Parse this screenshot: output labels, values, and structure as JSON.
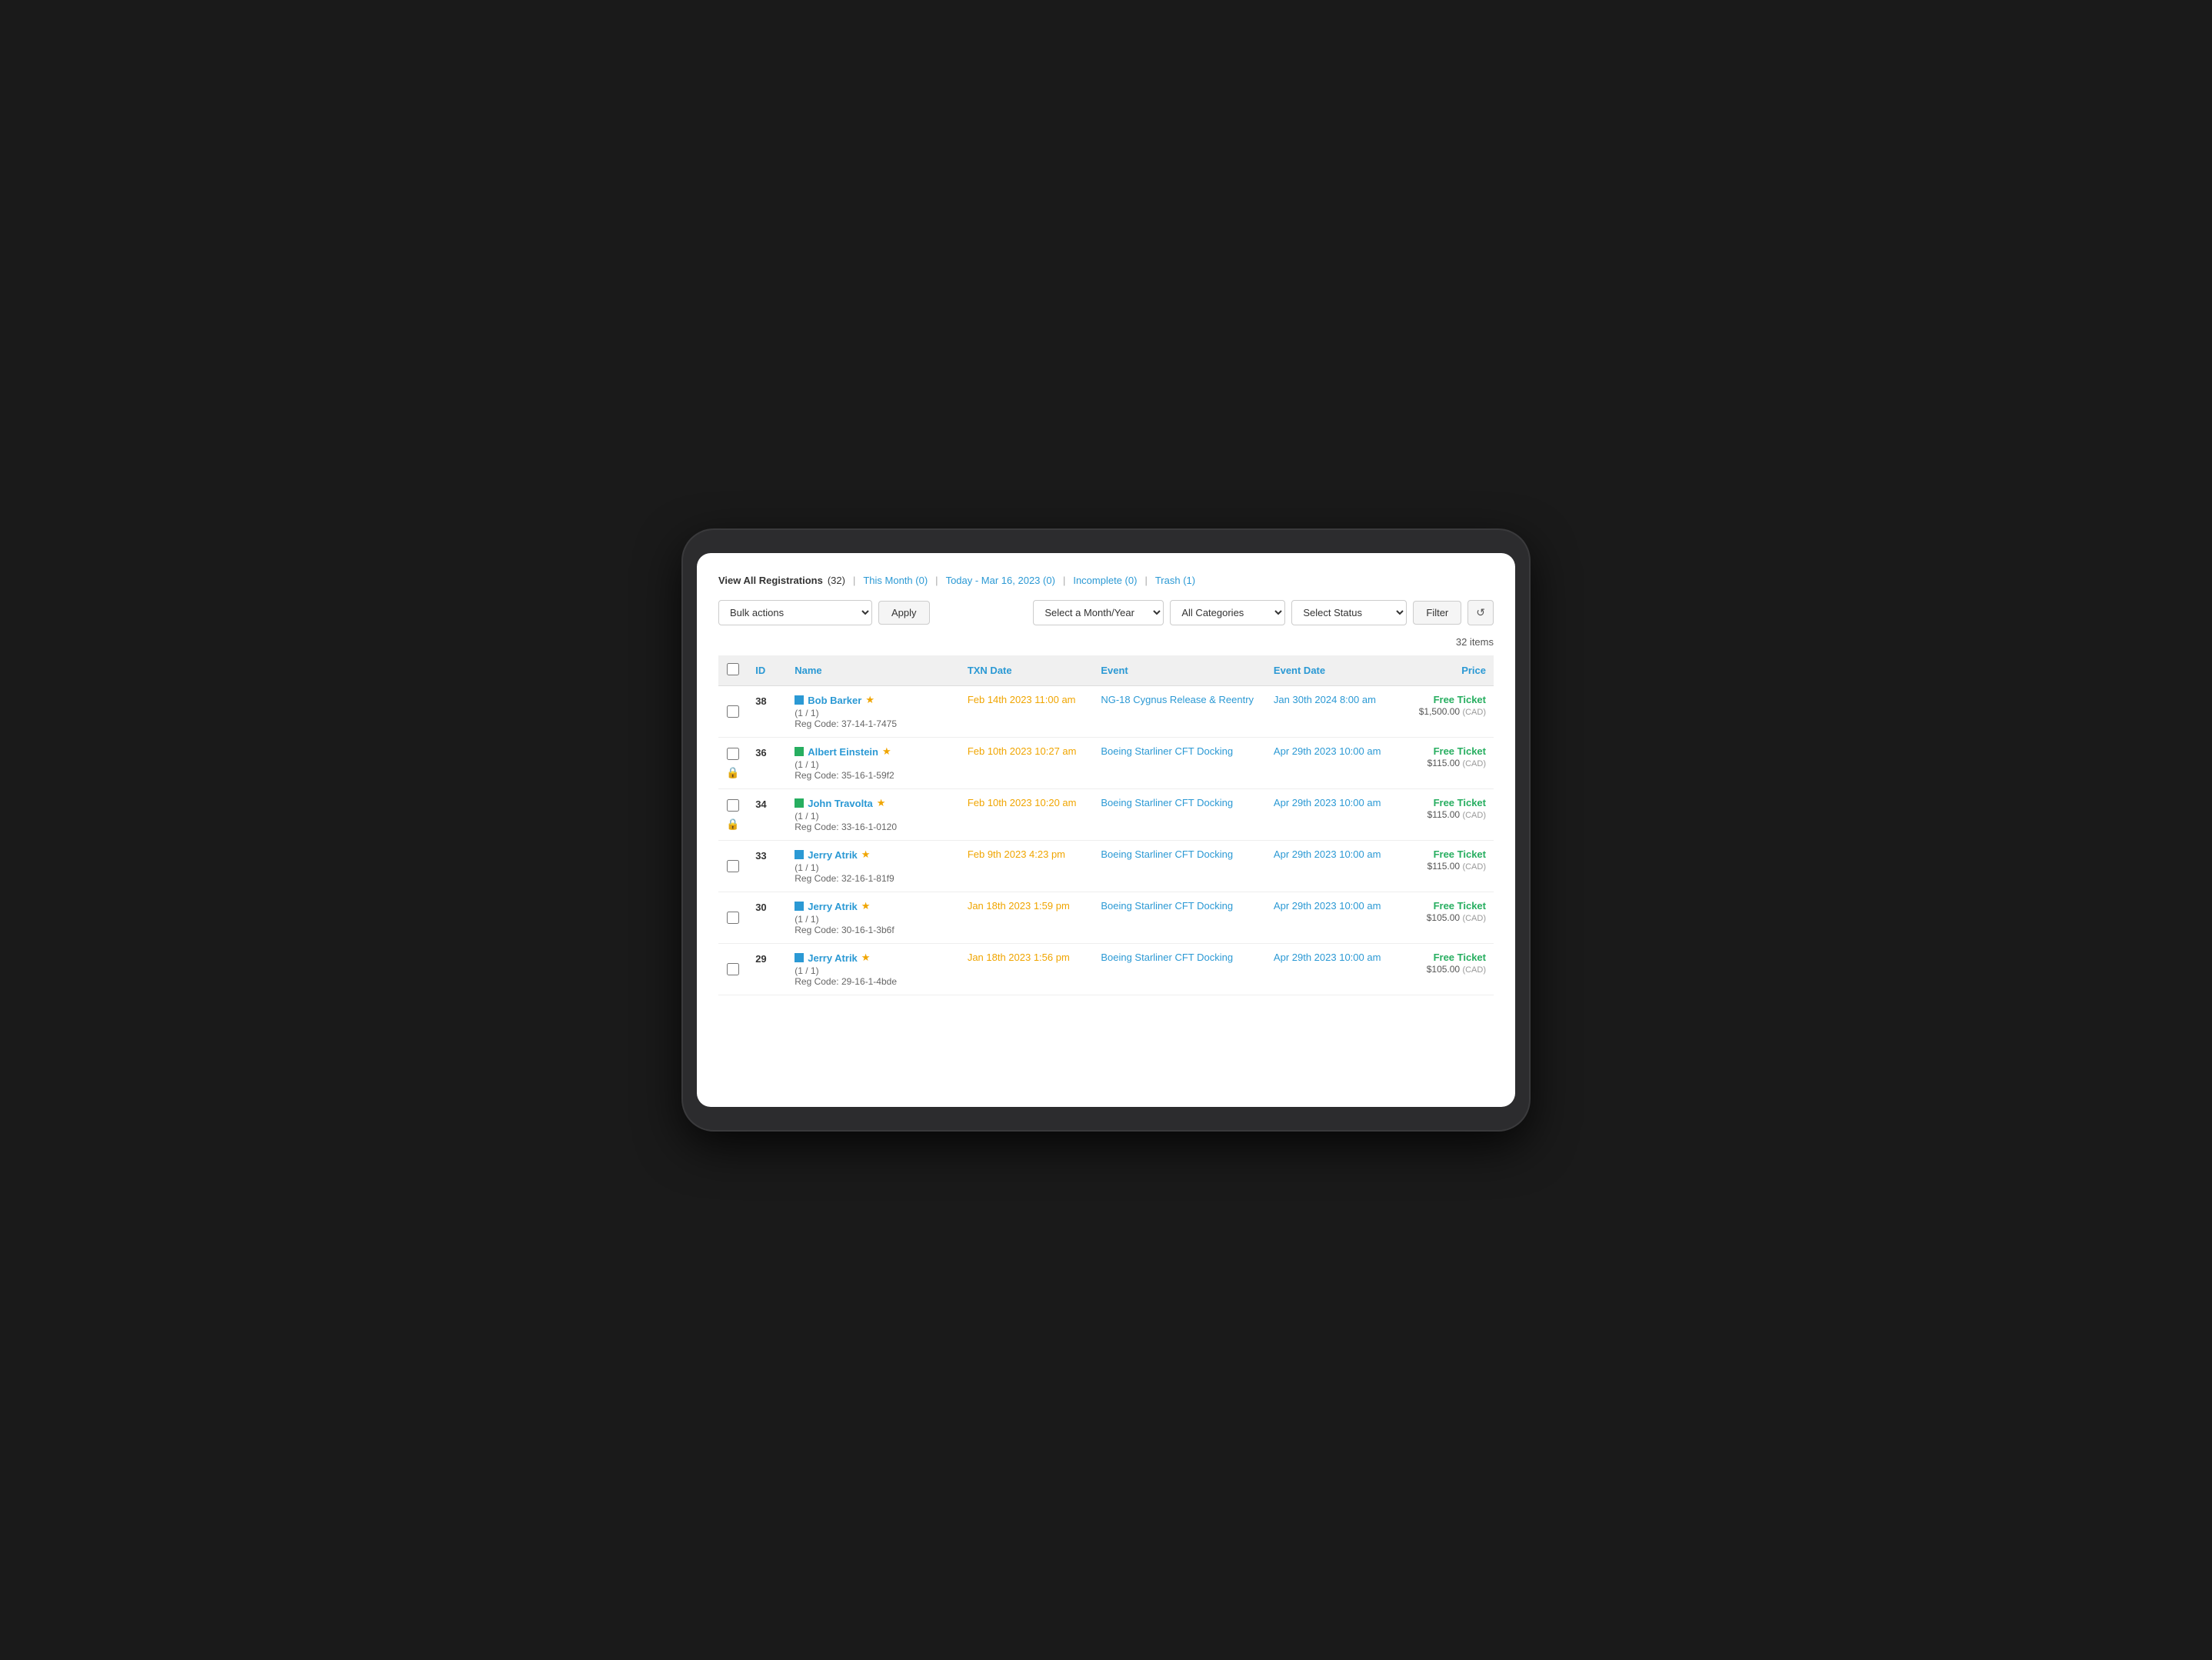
{
  "header": {
    "view_all_label": "View All Registrations",
    "view_all_count": "(32)",
    "sep1": "|",
    "this_month_label": "This Month",
    "this_month_count": "(0)",
    "sep2": "|",
    "today_label": "Today - Mar 16, 2023",
    "today_count": "(0)",
    "sep3": "|",
    "incomplete_label": "Incomplete",
    "incomplete_count": "(0)",
    "sep4": "|",
    "trash_label": "Trash",
    "trash_count": "(1)"
  },
  "toolbar": {
    "bulk_actions_label": "Bulk actions",
    "apply_label": "Apply",
    "month_year_placeholder": "Select a Month/Year",
    "categories_placeholder": "All Categories",
    "status_placeholder": "Select Status",
    "filter_label": "Filter",
    "refresh_icon": "↺"
  },
  "items_count": "32 items",
  "table": {
    "columns": [
      "",
      "ID",
      "Name",
      "TXN Date",
      "Event",
      "Event Date",
      "Price"
    ],
    "rows": [
      {
        "id": 38,
        "color": "#2b99d4",
        "name": "Bob Barker",
        "starred": true,
        "sub_info": "(1 / 1)",
        "reg_code": "Reg Code: 37-14-1-7475",
        "txn_date": "Feb 14th 2023 11:00 am",
        "event": "NG-18 Cygnus Release & Reentry",
        "event_date": "Jan 30th 2024 8:00 am",
        "free_ticket": "Free Ticket",
        "price": "$1,500.00",
        "currency": "(CAD)",
        "locked": false
      },
      {
        "id": 36,
        "color": "#27ae60",
        "name": "Albert Einstein",
        "starred": true,
        "sub_info": "(1 / 1)",
        "reg_code": "Reg Code: 35-16-1-59f2",
        "txn_date": "Feb 10th 2023 10:27 am",
        "event": "Boeing Starliner CFT Docking",
        "event_date": "Apr 29th 2023 10:00 am",
        "free_ticket": "Free Ticket",
        "price": "$115.00",
        "currency": "(CAD)",
        "locked": true
      },
      {
        "id": 34,
        "color": "#27ae60",
        "name": "John Travolta",
        "starred": true,
        "sub_info": "(1 / 1)",
        "reg_code": "Reg Code: 33-16-1-0120",
        "txn_date": "Feb 10th 2023 10:20 am",
        "event": "Boeing Starliner CFT Docking",
        "event_date": "Apr 29th 2023 10:00 am",
        "free_ticket": "Free Ticket",
        "price": "$115.00",
        "currency": "(CAD)",
        "locked": true
      },
      {
        "id": 33,
        "color": "#2b99d4",
        "name": "Jerry Atrik",
        "starred": true,
        "sub_info": "(1 / 1)",
        "reg_code": "Reg Code: 32-16-1-81f9",
        "txn_date": "Feb 9th 2023 4:23 pm",
        "event": "Boeing Starliner CFT Docking",
        "event_date": "Apr 29th 2023 10:00 am",
        "free_ticket": "Free Ticket",
        "price": "$115.00",
        "currency": "(CAD)",
        "locked": false
      },
      {
        "id": 30,
        "color": "#2b99d4",
        "name": "Jerry Atrik",
        "starred": true,
        "sub_info": "(1 / 1)",
        "reg_code": "Reg Code: 30-16-1-3b6f",
        "txn_date": "Jan 18th 2023 1:59 pm",
        "event": "Boeing Starliner CFT Docking",
        "event_date": "Apr 29th 2023 10:00 am",
        "free_ticket": "Free Ticket",
        "price": "$105.00",
        "currency": "(CAD)",
        "locked": false
      },
      {
        "id": 29,
        "color": "#2b99d4",
        "name": "Jerry Atrik",
        "starred": true,
        "sub_info": "(1 / 1)",
        "reg_code": "Reg Code: 29-16-1-4bde",
        "txn_date": "Jan 18th 2023 1:56 pm",
        "event": "Boeing Starliner CFT Docking",
        "event_date": "Apr 29th 2023 10:00 am",
        "free_ticket": "Free Ticket",
        "price": "$105.00",
        "currency": "(CAD)",
        "locked": false
      }
    ]
  }
}
